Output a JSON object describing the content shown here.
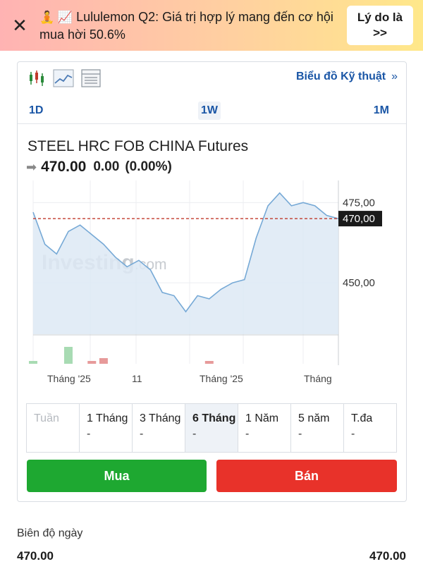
{
  "banner": {
    "close_label": "✕",
    "emojis": "🧘 📈",
    "text": "Lululemon Q2: Giá trị hợp lý mang đến cơ hội mua hời 50.6%",
    "button_label": "Lý do là >>",
    "gradient_start": "#ffb3b3",
    "gradient_end": "#ffe88a"
  },
  "toolbar": {
    "icons": [
      "candlestick-chart-icon",
      "line-chart-icon",
      "table-icon"
    ],
    "tech_link": "Biểu đồ Kỹ thuật",
    "tech_link_chevron": "»"
  },
  "intervals": [
    {
      "label": "1D",
      "active": false
    },
    {
      "label": "1W",
      "active": true
    },
    {
      "label": "1M",
      "active": false
    }
  ],
  "instrument": {
    "name": "STEEL HRC FOB CHINA Futures",
    "price": "470.00",
    "change": "0.00",
    "change_pct": "(0.00%)"
  },
  "chart_data": {
    "type": "area",
    "watermark": "Investing",
    "watermark_suffix": ".com",
    "y_ticks": [
      "475,00",
      "450,00"
    ],
    "current_price_label": "470,00",
    "x_ticks": [
      "Tháng '25",
      "11",
      "Tháng '25",
      "Tháng"
    ],
    "ylim": [
      434,
      481
    ],
    "series": [
      {
        "values": [
          472,
          462,
          459,
          466,
          468,
          465,
          462,
          458,
          455,
          457,
          454,
          447,
          446,
          441,
          446,
          445,
          448,
          450,
          451,
          464,
          474,
          478,
          474,
          475,
          474,
          471,
          470
        ]
      }
    ],
    "volume": [
      1,
      0,
      0,
      6,
      0,
      1,
      2,
      0,
      0,
      0,
      0,
      0,
      0,
      0,
      0,
      1,
      0,
      0,
      0,
      0,
      0,
      0,
      0,
      0,
      0,
      0,
      0
    ],
    "volume_colors": [
      "up",
      "none",
      "none",
      "up",
      "none",
      "down",
      "down",
      "none",
      "none",
      "none",
      "none",
      "none",
      "none",
      "none",
      "none",
      "down",
      "none",
      "none",
      "none",
      "none",
      "none",
      "none",
      "none",
      "none",
      "none",
      "none",
      "none"
    ],
    "colors": {
      "line": "#76a9d6",
      "fill": "#dde9f5",
      "price_line": "#c0392b",
      "up": "#a8dbb3",
      "down": "#e79a9a"
    }
  },
  "ranges": [
    {
      "label": "Tuần",
      "value": "",
      "active": false,
      "faded": true
    },
    {
      "label": "1 Tháng",
      "value": "-",
      "active": false,
      "faded": false
    },
    {
      "label": "3 Tháng",
      "value": "-",
      "active": false,
      "faded": false
    },
    {
      "label": "6 Tháng",
      "value": "-",
      "active": true,
      "faded": false
    },
    {
      "label": "1 Năm",
      "value": "-",
      "active": false,
      "faded": false
    },
    {
      "label": "5 năm",
      "value": "-",
      "active": false,
      "faded": false
    },
    {
      "label": "T.đa",
      "value": "-",
      "active": false,
      "faded": false
    }
  ],
  "actions": {
    "buy": "Mua",
    "sell": "Bán",
    "buy_color": "#1ea831",
    "sell_color": "#e8322a"
  },
  "day_range": {
    "label": "Biên độ ngày",
    "low": "470.00",
    "high": "470.00"
  }
}
